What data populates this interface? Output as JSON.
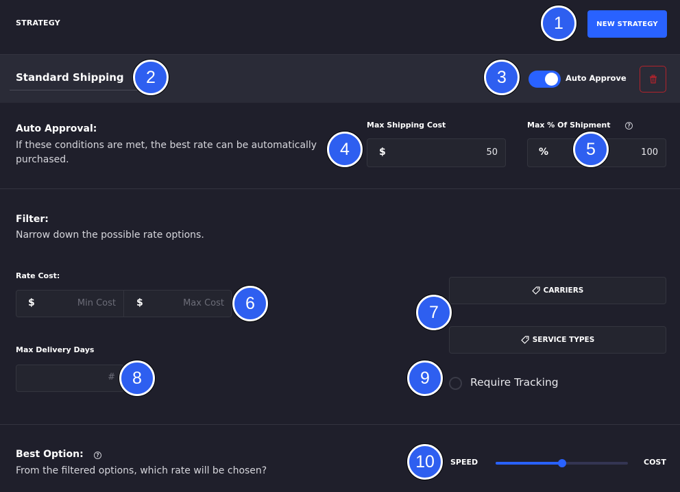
{
  "header": {
    "title": "STRATEGY",
    "new_button": "NEW STRATEGY"
  },
  "strategy": {
    "name": "Standard Shipping",
    "auto_approve_label": "Auto Approve",
    "auto_approve_on": true
  },
  "auto_approval": {
    "title": "Auto Approval:",
    "description": "If these conditions are met, the best rate can be automatically purchased.",
    "max_cost": {
      "label": "Max Shipping Cost",
      "prefix": "$",
      "value": "50"
    },
    "max_pct": {
      "label": "Max % Of Shipment",
      "prefix": "%",
      "value": "100"
    }
  },
  "filter": {
    "title": "Filter:",
    "description": "Narrow down the possible rate options.",
    "rate_cost": {
      "label": "Rate Cost:",
      "min_prefix": "$",
      "min_placeholder": "Min Cost",
      "max_prefix": "$",
      "max_placeholder": "Max Cost"
    },
    "max_days": {
      "label": "Max Delivery Days",
      "placeholder": "#"
    },
    "carriers_label": "CARRIERS",
    "service_types_label": "SERVICE TYPES",
    "require_tracking_label": "Require Tracking"
  },
  "best_option": {
    "title": "Best Option:",
    "description": "From the filtered options, which rate will be chosen?",
    "left_label": "SPEED",
    "right_label": "COST",
    "slider_value": 0.5
  },
  "icons": {
    "delete": "trash-icon",
    "help": "question-circle-icon",
    "tag": "tag-icon"
  },
  "colors": {
    "accent": "#2962ff",
    "danger": "#b3232c",
    "background": "#1f1f2b",
    "panel": "#2a2b37"
  },
  "markers": [
    "1",
    "2",
    "3",
    "4",
    "5",
    "6",
    "7",
    "8",
    "9",
    "10"
  ]
}
